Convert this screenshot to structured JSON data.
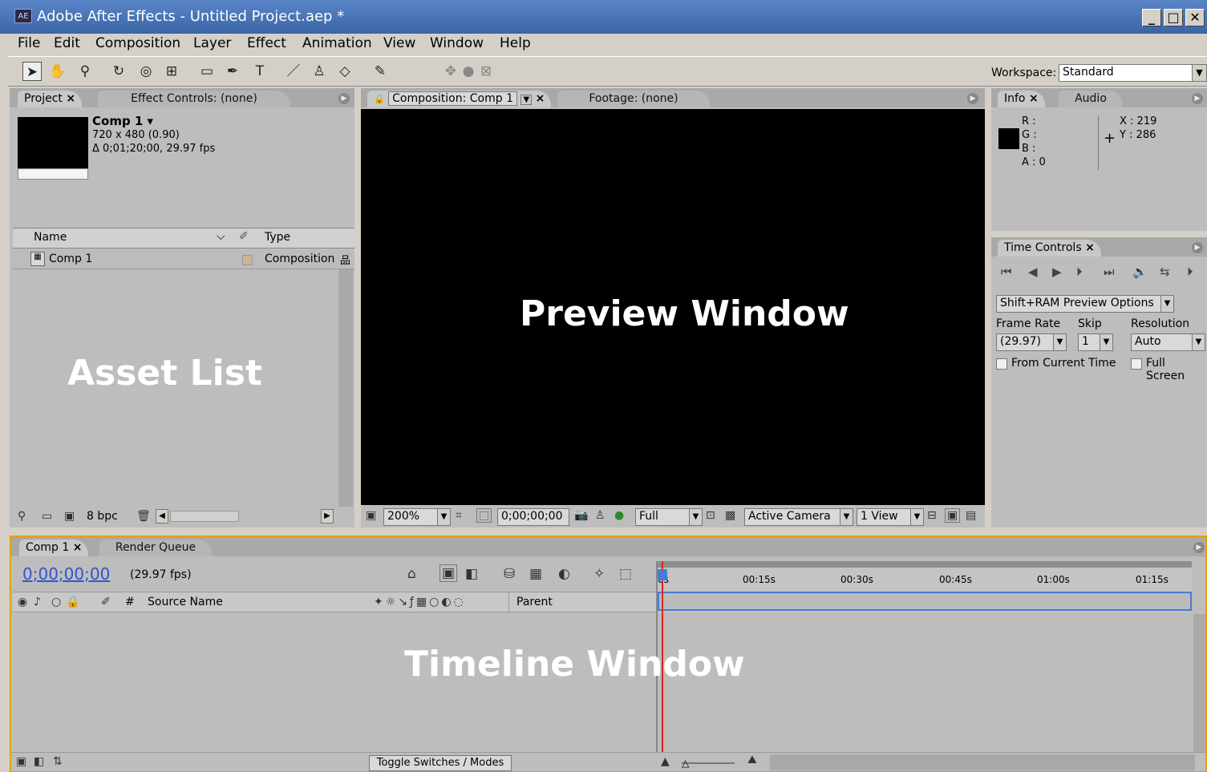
{
  "window": {
    "app_icon_text": "AE",
    "title": "Adobe After Effects - Untitled Project.aep *",
    "minimize": "_",
    "maximize": "□",
    "close": "✕"
  },
  "menu": [
    "File",
    "Edit",
    "Composition",
    "Layer",
    "Effect",
    "Animation",
    "View",
    "Window",
    "Help"
  ],
  "workspace": {
    "label": "Workspace:",
    "value": "Standard"
  },
  "project_panel": {
    "tabs": [
      "Project",
      "Effect Controls: (none)"
    ],
    "comp_name": "Comp 1 ▾",
    "comp_dims": "720 x 480 (0.90)",
    "comp_duration": "Δ 0;01;20;00, 29.97 fps",
    "columns": [
      "Name",
      "Type"
    ],
    "items": [
      {
        "name": "Comp 1",
        "type": "Composition"
      }
    ],
    "bpc": "8 bpc",
    "overlay_label": "Asset List"
  },
  "comp_panel": {
    "tabs": [
      "Composition: Comp 1",
      "Footage: (none)"
    ],
    "overlay_label": "Preview Window",
    "zoom": "200%",
    "timecode": "0;00;00;00",
    "resolution": "Full",
    "camera": "Active Camera",
    "view": "1 View"
  },
  "info_panel": {
    "tabs": [
      "Info",
      "Audio"
    ],
    "r": "R :",
    "g": "G :",
    "b": "B :",
    "a": "A : 0",
    "x": "X : 219",
    "y": "Y : 286"
  },
  "time_controls": {
    "tab": "Time Controls",
    "preview_options": "Shift+RAM Preview Options",
    "frame_rate_label": "Frame Rate",
    "skip_label": "Skip",
    "resolution_label": "Resolution",
    "frame_rate": "(29.97)",
    "skip": "1",
    "resolution": "Auto",
    "from_current": "From Current Time",
    "full_screen": "Full Screen"
  },
  "timeline": {
    "tabs": [
      "Comp 1",
      "Render Queue"
    ],
    "time": "0;00;00;00",
    "fps": "(29.97 fps)",
    "col_hash": "#",
    "col_source": "Source Name",
    "col_parent": "Parent",
    "ruler": [
      "0s",
      "00:15s",
      "00:30s",
      "00:45s",
      "01:00s",
      "01:15s"
    ],
    "overlay_label": "Timeline Window",
    "toggle": "Toggle Switches / Modes"
  },
  "colors": {
    "titlebar": "#3a64a6",
    "timeline_border": "#e8a000",
    "cti": "#e02020",
    "timecode": "#3355cc"
  }
}
